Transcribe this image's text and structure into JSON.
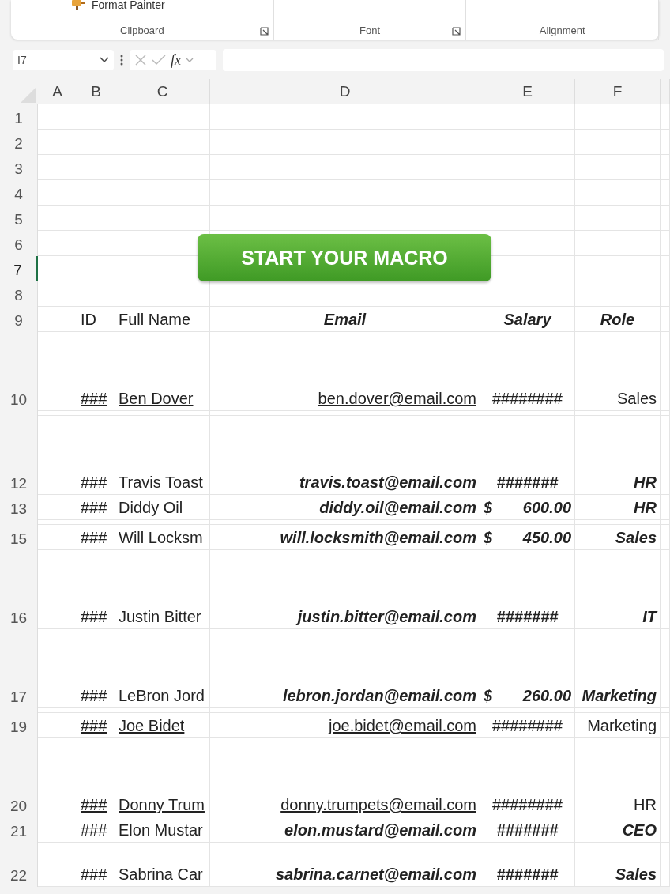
{
  "ribbon": {
    "format_painter": "Format Painter",
    "groups": [
      {
        "label": "Clipboard",
        "launcher": true
      },
      {
        "label": "Font",
        "launcher": true
      },
      {
        "label": "Alignment",
        "launcher": false
      }
    ]
  },
  "formula_bar": {
    "name_box": "I7",
    "fx": "fx"
  },
  "columns": [
    "A",
    "B",
    "C",
    "D",
    "E",
    "F"
  ],
  "macro_button": "START YOUR MACRO",
  "rows": [
    {
      "number": "1",
      "kind": "normal",
      "selected": false
    },
    {
      "number": "2",
      "kind": "normal",
      "selected": false
    },
    {
      "number": "3",
      "kind": "normal",
      "selected": false
    },
    {
      "number": "4",
      "kind": "normal",
      "selected": false
    },
    {
      "number": "5",
      "kind": "normal",
      "selected": false
    },
    {
      "number": "6",
      "kind": "normal",
      "selected": false
    },
    {
      "number": "7",
      "kind": "normal",
      "selected": true
    },
    {
      "number": "8",
      "kind": "normal",
      "selected": false
    },
    {
      "number": "9",
      "kind": "header",
      "selected": false,
      "cells": {
        "id": "ID",
        "name": "Full Name",
        "email": "Email",
        "salary": "Salary",
        "role": "Role"
      }
    },
    {
      "number": "10",
      "kind": "tall",
      "selected": false,
      "hyperlink": true,
      "cells": {
        "id": "###",
        "name": "Ben Dover",
        "email": "ben.dover@email.com",
        "salary": "########",
        "role": "Sales"
      }
    },
    {
      "kind": "thin",
      "selected": false
    },
    {
      "number": "12",
      "kind": "tall",
      "selected": false,
      "hyperlink": false,
      "cells": {
        "id": "###",
        "name": "Travis Toast",
        "email": "travis.toast@email.com",
        "salary": "#######",
        "role": "HR"
      }
    },
    {
      "number": "13",
      "kind": "normal",
      "selected": false,
      "hyperlink": false,
      "cells": {
        "id": "###",
        "name": "Diddy Oil",
        "email": "diddy.oil@email.com",
        "currency": "$",
        "salary": "600.00",
        "role": "HR"
      }
    },
    {
      "kind": "thin",
      "selected": false
    },
    {
      "number": "15",
      "kind": "normal",
      "selected": false,
      "hyperlink": false,
      "cells": {
        "id": "###",
        "name": "Will Locksm",
        "email": "will.locksmith@email.com",
        "currency": "$",
        "salary": "450.00",
        "role": "Sales"
      }
    },
    {
      "number": "16",
      "kind": "tall",
      "selected": false,
      "hyperlink": false,
      "cells": {
        "id": "###",
        "name": "Justin Bitter",
        "email": "justin.bitter@email.com",
        "salary": "#######",
        "role": "IT"
      }
    },
    {
      "number": "17",
      "kind": "tall",
      "selected": false,
      "hyperlink": false,
      "cells": {
        "id": "###",
        "name": "LeBron Jord",
        "email": "lebron.jordan@email.com",
        "currency": "$",
        "salary": "260.00",
        "role": "Marketing"
      }
    },
    {
      "kind": "thin",
      "selected": false
    },
    {
      "number": "19",
      "kind": "normal",
      "selected": false,
      "hyperlink": true,
      "cells": {
        "id": "###",
        "name": "Joe Bidet",
        "email": "joe.bidet@email.com",
        "salary": "########",
        "role": "Marketing"
      }
    },
    {
      "number": "20",
      "kind": "tall",
      "selected": false,
      "hyperlink": true,
      "cells": {
        "id": "###",
        "name": "Donny Trum",
        "email": "donny.trumpets@email.com",
        "salary": "########",
        "role": "HR"
      }
    },
    {
      "number": "21",
      "kind": "normal",
      "selected": false,
      "hyperlink": false,
      "cells": {
        "id": "###",
        "name": "Elon Mustar",
        "email": "elon.mustard@email.com",
        "salary": "#######",
        "role": "CEO"
      }
    },
    {
      "number": "22",
      "kind": "cut",
      "selected": false,
      "hyperlink": false,
      "cells": {
        "id": "###",
        "name": "Sabrina Car",
        "email": "sabrina.carnet@email.com",
        "salary": "#######",
        "role": "Sales"
      }
    }
  ]
}
